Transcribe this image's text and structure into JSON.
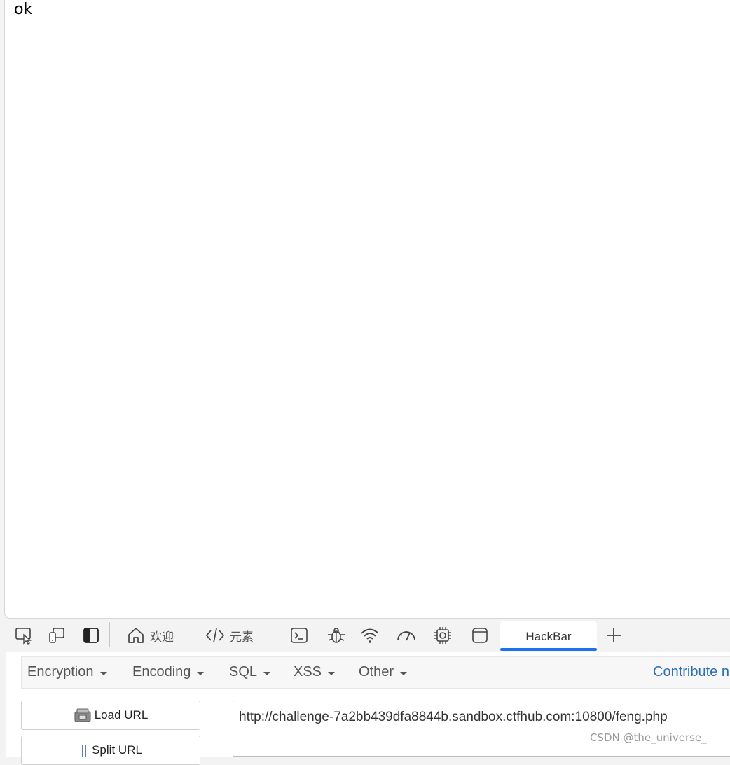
{
  "page": {
    "body_text": "ok"
  },
  "devtools": {
    "tabs": {
      "welcome_label": "欢迎",
      "elements_label": "元素",
      "hackbar_label": "HackBar"
    },
    "icons": [
      "inspect-icon",
      "device-emulation-icon",
      "dock-side-icon",
      "home-icon",
      "code-icon",
      "console-icon",
      "bug-icon",
      "network-icon",
      "performance-icon",
      "memory-icon",
      "application-icon",
      "add-tab-icon"
    ],
    "accent_color": "#1a73e8"
  },
  "hackbar": {
    "menu": {
      "encryption": "Encryption",
      "encoding": "Encoding",
      "sql": "SQL",
      "xss": "XSS",
      "other": "Other",
      "contribute": "Contribute n"
    },
    "buttons": {
      "load_url": "Load URL",
      "split_url": "Split URL"
    },
    "url_value": "http://challenge-7a2bb439dfa8844b.sandbox.ctfhub.com:10800/feng.php"
  },
  "watermark": "CSDN @the_universe_"
}
